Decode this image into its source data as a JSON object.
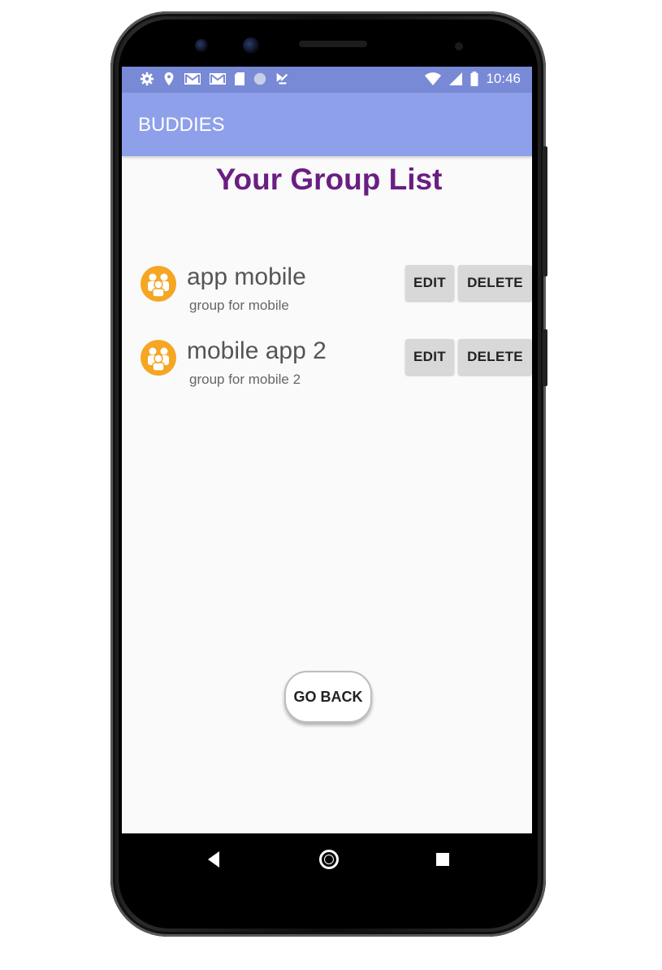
{
  "status_bar": {
    "time": "10:46",
    "icons": [
      "settings-icon",
      "location-icon",
      "gmail-icon",
      "gmail-icon",
      "sd-card-icon",
      "circle-icon",
      "app-notification-icon",
      "wifi-icon",
      "signal-icon",
      "battery-icon"
    ]
  },
  "app_bar": {
    "title": "BUDDIES"
  },
  "page": {
    "title": "Your Group List"
  },
  "groups": [
    {
      "name": "app mobile",
      "description": "group for mobile",
      "edit_label": "EDIT",
      "delete_label": "DELETE",
      "icon": "group-icon"
    },
    {
      "name": "mobile app 2",
      "description": "group for mobile 2",
      "edit_label": "EDIT",
      "delete_label": "DELETE",
      "icon": "group-icon"
    }
  ],
  "go_back_label": "GO BACK",
  "colors": {
    "status_bar": "#7889d6",
    "app_bar": "#8ea0ea",
    "title": "#6a1e82",
    "group_icon": "#f5a623",
    "button": "#d8d8d8"
  },
  "nav_bar": {
    "icons": [
      "back-icon",
      "home-icon",
      "recents-icon"
    ]
  }
}
